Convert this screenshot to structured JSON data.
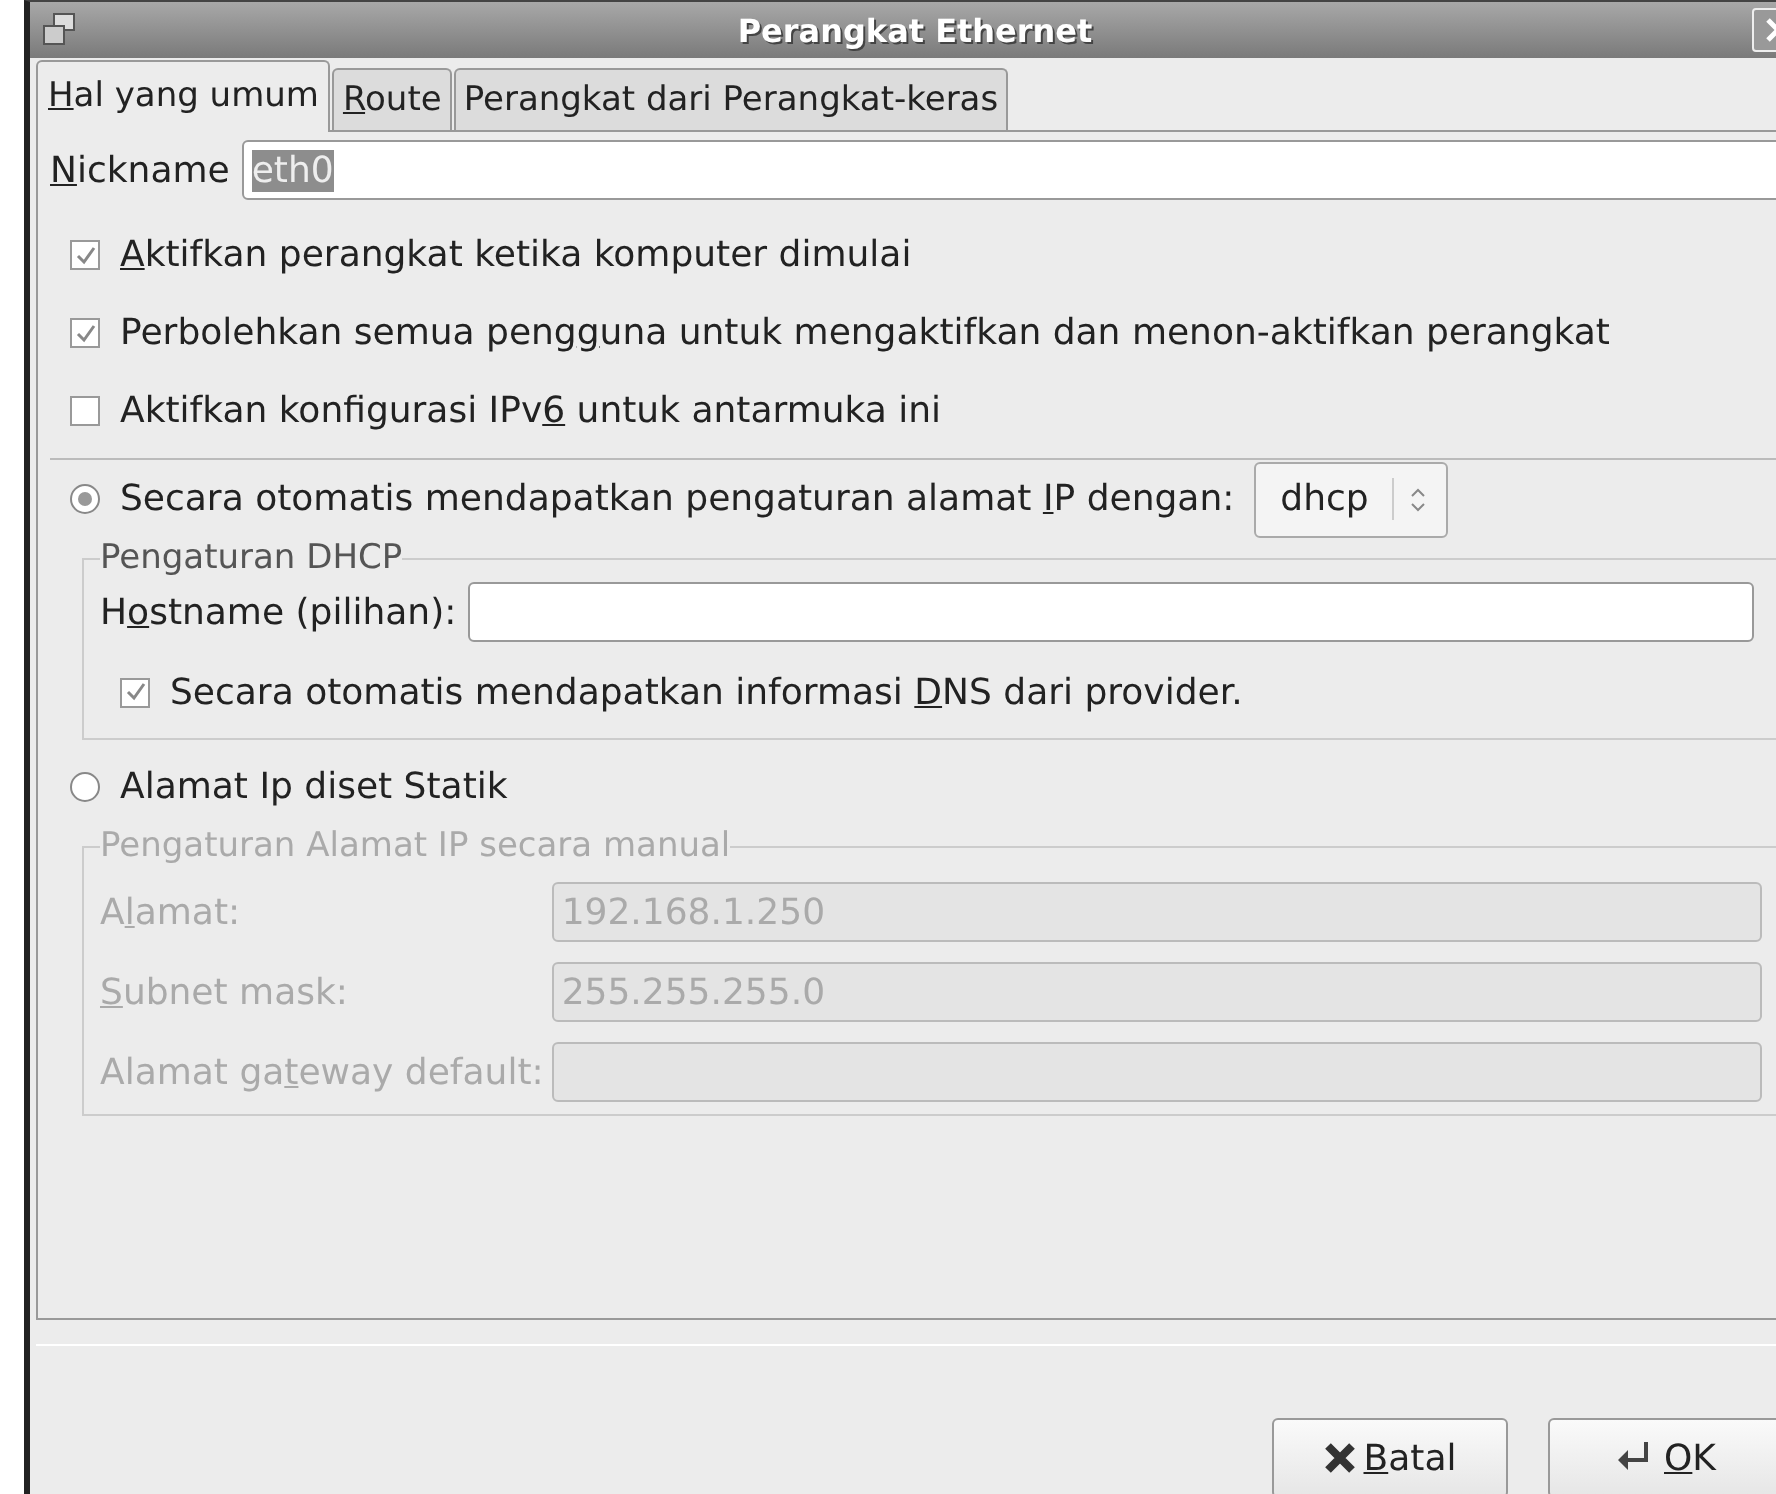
{
  "window": {
    "title": "Perangkat Ethernet"
  },
  "tabs": [
    {
      "label": {
        "key": "H",
        "post": "al yang umum"
      },
      "selected": true
    },
    {
      "label": {
        "key": "R",
        "post": "oute"
      },
      "selected": false
    },
    {
      "label": {
        "post": "Perangkat dari Perangkat-keras"
      },
      "selected": false
    }
  ],
  "nickname": {
    "label": {
      "key": "N",
      "post": "ickname"
    },
    "value": "eth0",
    "text_selected": true
  },
  "options": [
    {
      "label": {
        "key": "A",
        "post": "ktifkan perangkat ketika komputer dimulai"
      },
      "checked": true
    },
    {
      "label": {
        "pre": "Perbolehkan semua peng",
        "key": "g",
        "post": "una untuk mengaktifkan dan menon-aktifkan perangkat"
      },
      "checked": true
    },
    {
      "label": {
        "pre": "Aktifkan konfigurasi IPv",
        "key": "6",
        "post": " untuk antarmuka ini"
      },
      "checked": false
    }
  ],
  "auto_ip": {
    "label": {
      "pre": "Secara otomatis mendapatkan pengaturan alamat ",
      "key": "I",
      "post": "P dengan:"
    },
    "selected": true,
    "protocol": "dhcp"
  },
  "dhcp_group": {
    "title": "Pengaturan DHCP",
    "disabled": false,
    "hostname": {
      "label": {
        "pre": "H",
        "key": "o",
        "post": "stname (pilihan):"
      }
    },
    "dns": {
      "label": {
        "pre": "Secara otomatis mendapatkan informasi ",
        "key": "D",
        "post": "NS dari provider."
      },
      "checked": true
    }
  },
  "static_ip": {
    "label": {
      "post": "Alamat Ip diset Statik"
    },
    "selected": false
  },
  "manual_group": {
    "title": "Pengaturan Alamat IP secara manual",
    "disabled": true,
    "fields": [
      {
        "label": {
          "pre": "A",
          "key": "l",
          "post": "amat:"
        },
        "value": "192.168.1.250"
      },
      {
        "label": {
          "key": "S",
          "post": "ubnet mask:"
        },
        "value": "255.255.255.0"
      },
      {
        "label": {
          "pre": "Alamat ga",
          "key": "t",
          "post": "eway default:"
        }
      }
    ]
  },
  "buttons": [
    {
      "kind": "cancel",
      "label": {
        "key": "B",
        "post": "atal"
      }
    },
    {
      "kind": "ok",
      "label": {
        "key": "O",
        "post": "K"
      }
    }
  ]
}
